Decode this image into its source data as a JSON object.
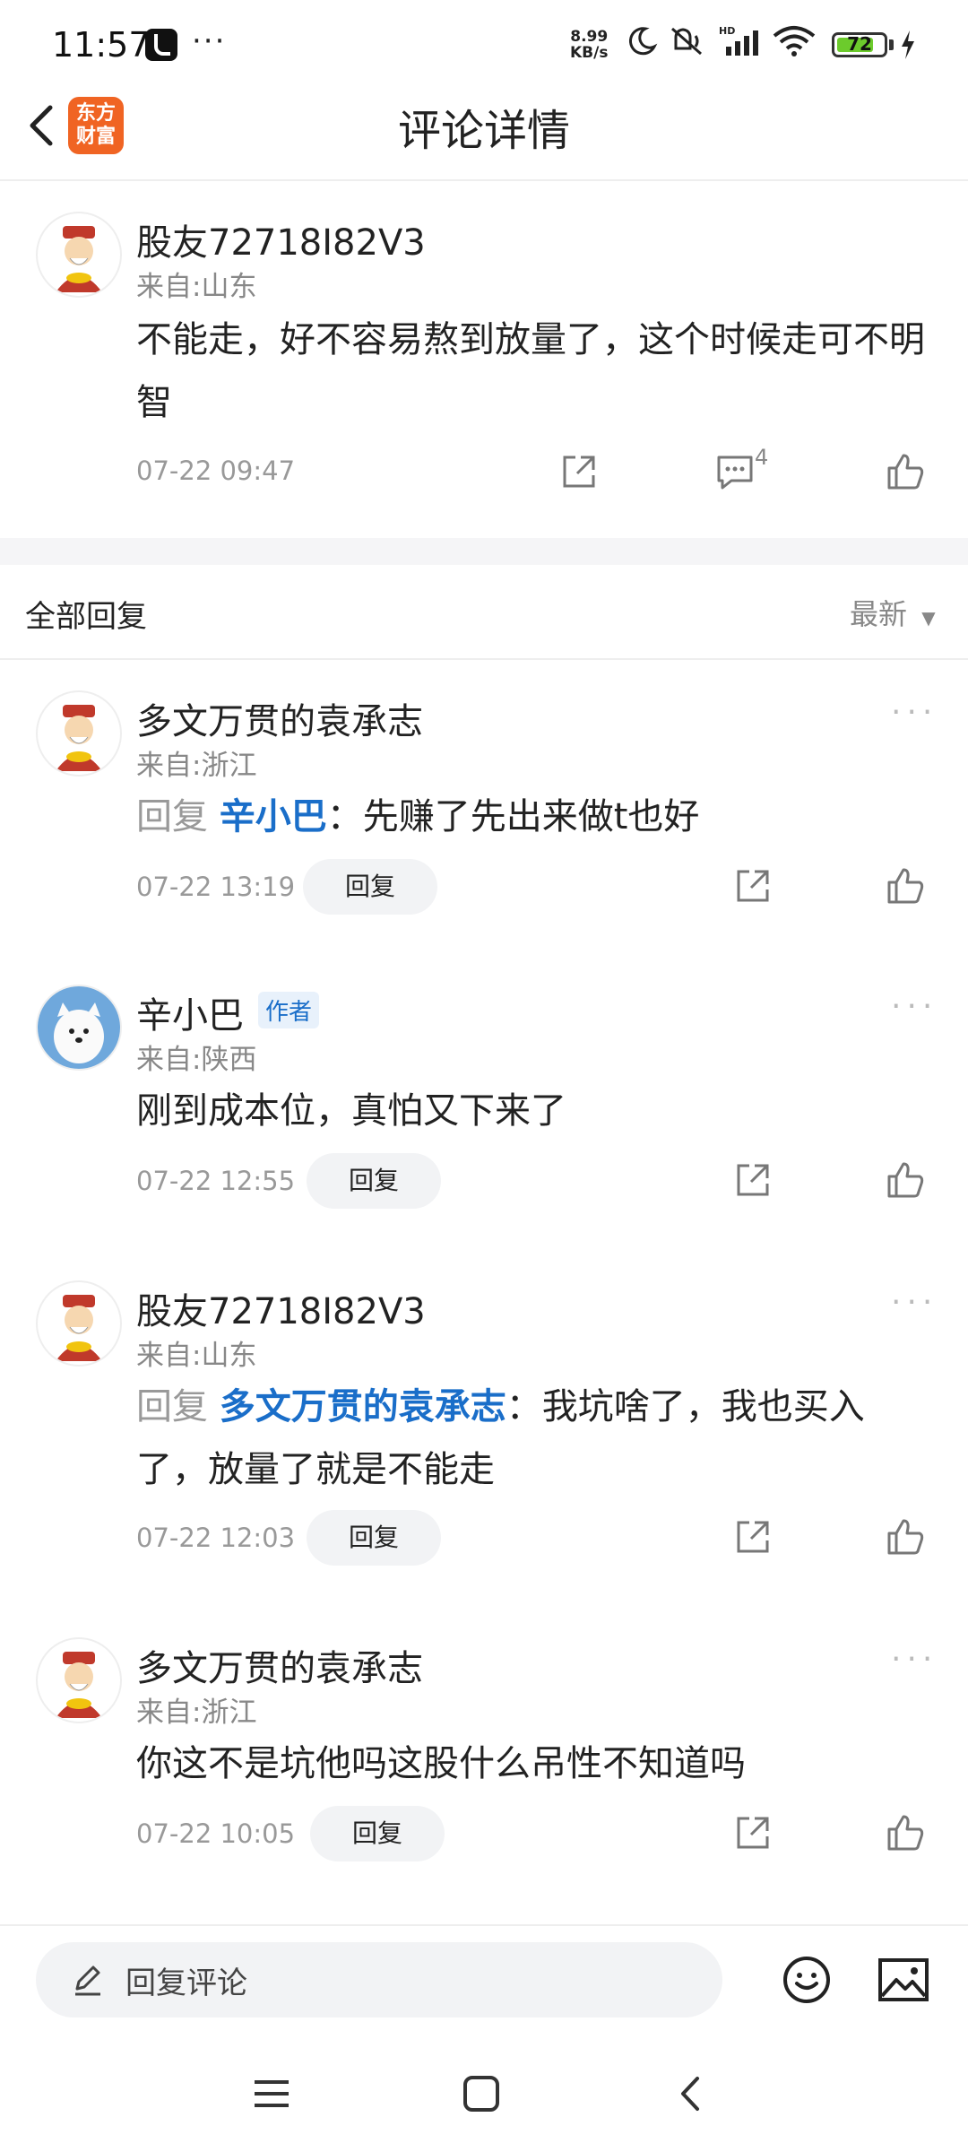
{
  "status_bar": {
    "time": "11:57",
    "more": "···",
    "net_speed": "8.99",
    "net_unit": "KB/s",
    "battery": "72"
  },
  "header": {
    "title": "评论详情",
    "logo_line1": "东方",
    "logo_line2": "财富"
  },
  "main_comment": {
    "name": "股友72718I82V3",
    "location": "来自:山东",
    "text": "不能走，好不容易熬到放量了，这个时候走可不明智",
    "time": "07-22 09:47",
    "comment_count": "4"
  },
  "replies_header": {
    "label": "全部回复",
    "sort": "最新"
  },
  "replies": [
    {
      "name": "多文万贯的袁承志",
      "location": "来自:浙江",
      "prefix": "回复 ",
      "target": "辛小巴",
      "text": "：先赚了先出来做t也好",
      "time": "07-22 13:19",
      "reply_label": "回复"
    },
    {
      "name": "辛小巴",
      "badge": "作者",
      "location": "来自:陕西",
      "text": "刚到成本位，真怕又下来了",
      "time": "07-22 12:55",
      "reply_label": "回复"
    },
    {
      "name": "股友72718I82V3",
      "location": "来自:山东",
      "prefix": "回复 ",
      "target": "多文万贯的袁承志",
      "text": "：我坑啥了，我也买入了，放量了就是不能走",
      "time": "07-22 12:03",
      "reply_label": "回复"
    },
    {
      "name": "多文万贯的袁承志",
      "location": "来自:浙江",
      "text": "你这不是坑他吗这股什么吊性不知道吗",
      "time": "07-22 10:05",
      "reply_label": "回复"
    }
  ],
  "bottom_bar": {
    "placeholder": "回复评论"
  }
}
